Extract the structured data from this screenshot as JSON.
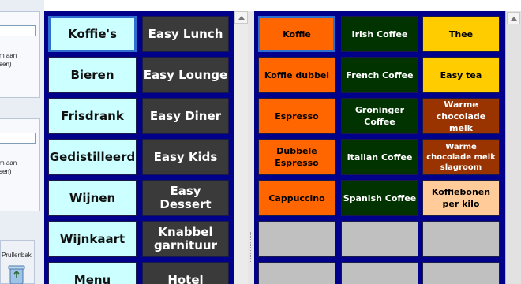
{
  "colors": {
    "panel_blue": "#00008b",
    "category_cyan": "#ccffff",
    "category_dark": "#3a3a3a",
    "product_orange": "#ff6600",
    "product_green": "#003300",
    "product_yellow": "#ffcc00",
    "product_brown": "#993300",
    "product_peach": "#ffcc99",
    "empty_grey": "#c0c0c0",
    "selected_border": "#2f6fd0"
  },
  "left_panel": {
    "fragment_text_1": "m aan\nsen)",
    "fragment_text_2": "m aan\nsen)",
    "trash_label": "Prullenbak",
    "trash_icon": "recycle-bin-icon"
  },
  "categories": {
    "column_1": [
      "Koffie's",
      "Bieren",
      "Frisdrank",
      "Gedistilleerd",
      "Wijnen",
      "Wijnkaart",
      "Menu"
    ],
    "column_2": [
      "Easy Lunch",
      "Easy Lounge",
      "Easy Diner",
      "Easy Kids",
      "Easy Dessert",
      "Knabbel garnituur",
      "Hotel"
    ],
    "selected": "Koffie's"
  },
  "products": [
    [
      "Koffie",
      "Irish Coffee",
      "Thee"
    ],
    [
      "Koffie dubbel",
      "French Coffee",
      "Easy tea"
    ],
    [
      "Espresso",
      "Groninger Coffee",
      "Warme chocolade melk"
    ],
    [
      "Dubbele Espresso",
      "Italian Coffee",
      "Warme chocolade melk slagroom"
    ],
    [
      "Cappuccino",
      "Spanish Coffee",
      "Koffiebonen per kilo"
    ],
    [
      "",
      "",
      ""
    ],
    [
      "",
      "",
      ""
    ]
  ],
  "product_colors": [
    [
      "orange",
      "green",
      "yellow"
    ],
    [
      "orange",
      "green",
      "yellow"
    ],
    [
      "orange",
      "green",
      "brown"
    ],
    [
      "orange",
      "green",
      "brown"
    ],
    [
      "orange",
      "green",
      "peach"
    ],
    [
      "grey",
      "grey",
      "grey"
    ],
    [
      "grey",
      "grey",
      "grey"
    ]
  ]
}
